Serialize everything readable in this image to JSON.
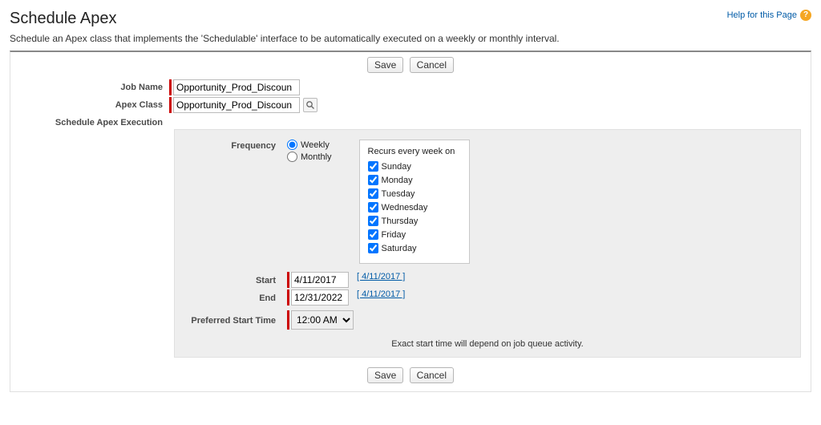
{
  "header": {
    "title": "Schedule Apex",
    "help_text": "Help for this Page"
  },
  "intro": "Schedule an Apex class that implements the 'Schedulable' interface to be automatically executed on a weekly or monthly interval.",
  "buttons": {
    "save": "Save",
    "cancel": "Cancel"
  },
  "labels": {
    "job_name": "Job Name",
    "apex_class": "Apex Class",
    "schedule_section": "Schedule Apex Execution",
    "frequency": "Frequency",
    "start": "Start",
    "end": "End",
    "preferred_start_time": "Preferred Start Time"
  },
  "values": {
    "job_name": "Opportunity_Prod_Discoun",
    "apex_class": "Opportunity_Prod_Discoun",
    "start_date": "4/11/2017",
    "start_date_link": "[ 4/11/2017 ]",
    "end_date": "12/31/2022",
    "end_date_link": "[ 4/11/2017 ]",
    "preferred_time": "12:00 AM"
  },
  "frequency": {
    "weekly": "Weekly",
    "monthly": "Monthly",
    "selected": "weekly",
    "recur_title": "Recurs every week on",
    "days": [
      {
        "label": "Sunday",
        "checked": true
      },
      {
        "label": "Monday",
        "checked": true
      },
      {
        "label": "Tuesday",
        "checked": true
      },
      {
        "label": "Wednesday",
        "checked": true
      },
      {
        "label": "Thursday",
        "checked": true
      },
      {
        "label": "Friday",
        "checked": true
      },
      {
        "label": "Saturday",
        "checked": true
      }
    ]
  },
  "hint": "Exact start time will depend on job queue activity."
}
